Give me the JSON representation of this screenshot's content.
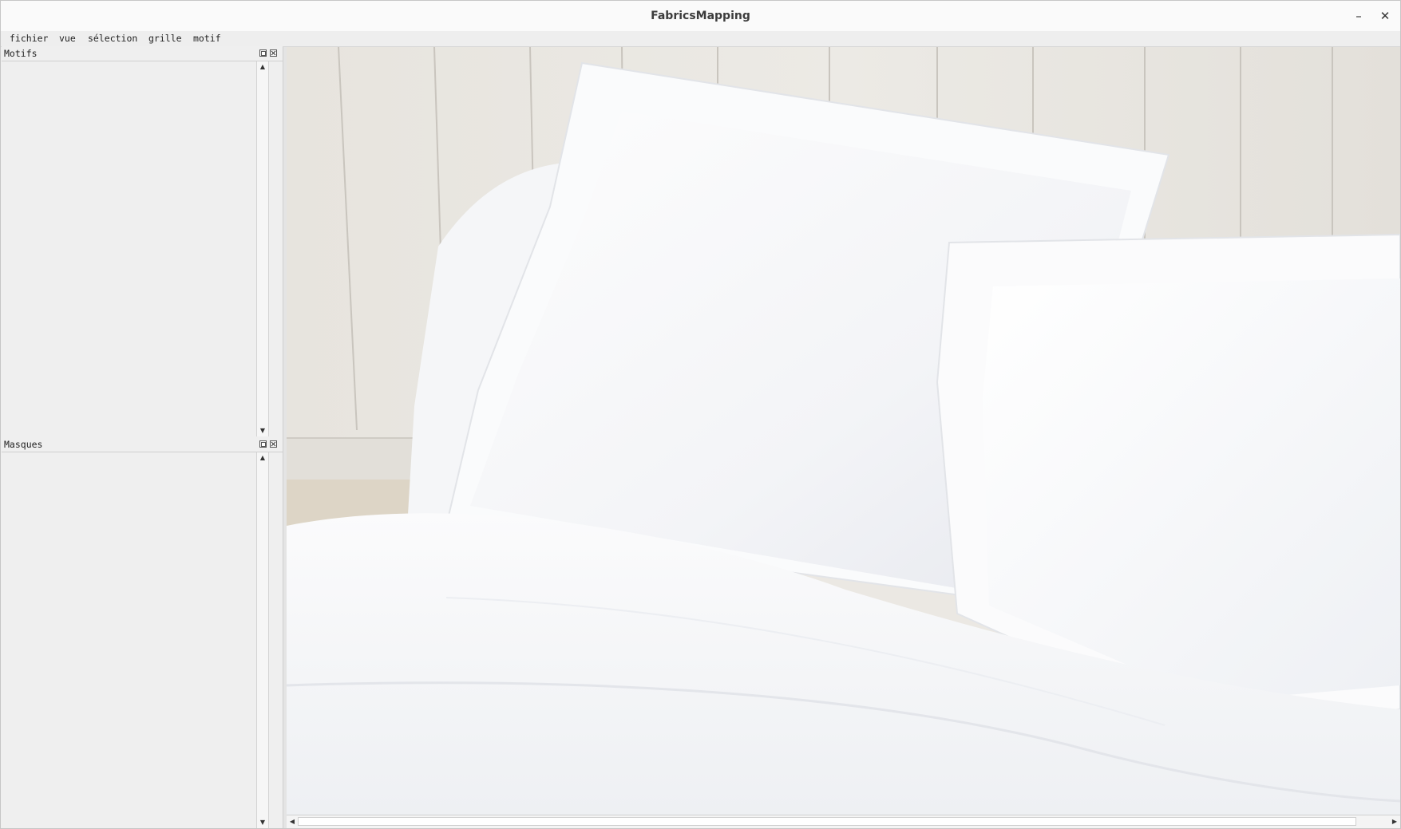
{
  "window": {
    "title": "FabricsMapping",
    "minimize_glyph": "–",
    "close_glyph": "✕"
  },
  "menubar": {
    "items": [
      "fichier",
      "vue",
      "sélection",
      "grille",
      "motif"
    ]
  },
  "docks": {
    "motifs": {
      "title": "Motifs"
    },
    "masques": {
      "title": "Masques"
    }
  },
  "scroll": {
    "up_glyph": "▲",
    "down_glyph": "▼",
    "left_glyph": "◀",
    "right_glyph": "▶"
  },
  "image": {
    "subject": "white bed pillows and linens against white wooden plank wall"
  }
}
